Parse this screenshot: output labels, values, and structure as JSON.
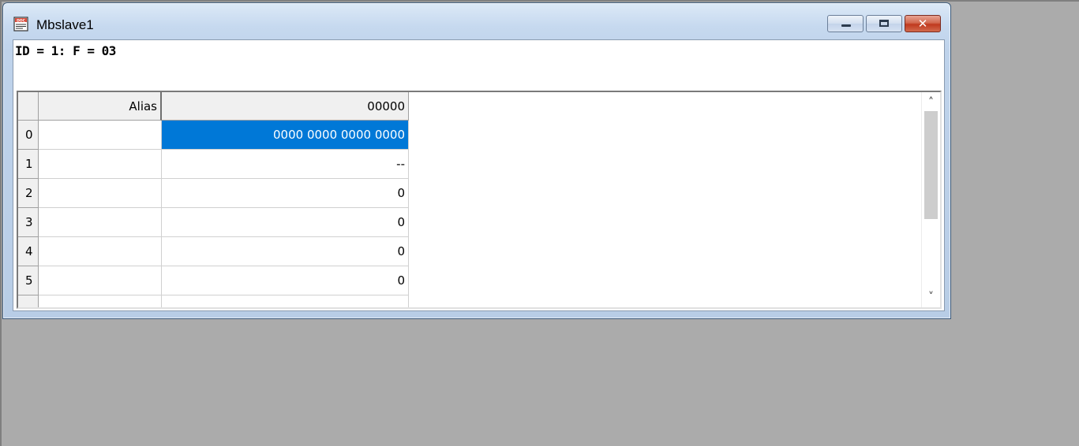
{
  "window": {
    "title": "Mbslave1",
    "icon": "doc-icon"
  },
  "info": {
    "text": "ID = 1: F = 03"
  },
  "grid": {
    "headers": {
      "alias": "Alias",
      "col0": "00000"
    },
    "rows": [
      {
        "index": "0",
        "alias": "",
        "value": "0000 0000 0000 0000",
        "selected": true
      },
      {
        "index": "1",
        "alias": "",
        "value": "--",
        "selected": false
      },
      {
        "index": "2",
        "alias": "",
        "value": "0",
        "selected": false
      },
      {
        "index": "3",
        "alias": "",
        "value": "0",
        "selected": false
      },
      {
        "index": "4",
        "alias": "",
        "value": "0",
        "selected": false
      },
      {
        "index": "5",
        "alias": "",
        "value": "0",
        "selected": false
      }
    ]
  },
  "colors": {
    "selection": "#0078d7",
    "desktop": "#ababab"
  }
}
